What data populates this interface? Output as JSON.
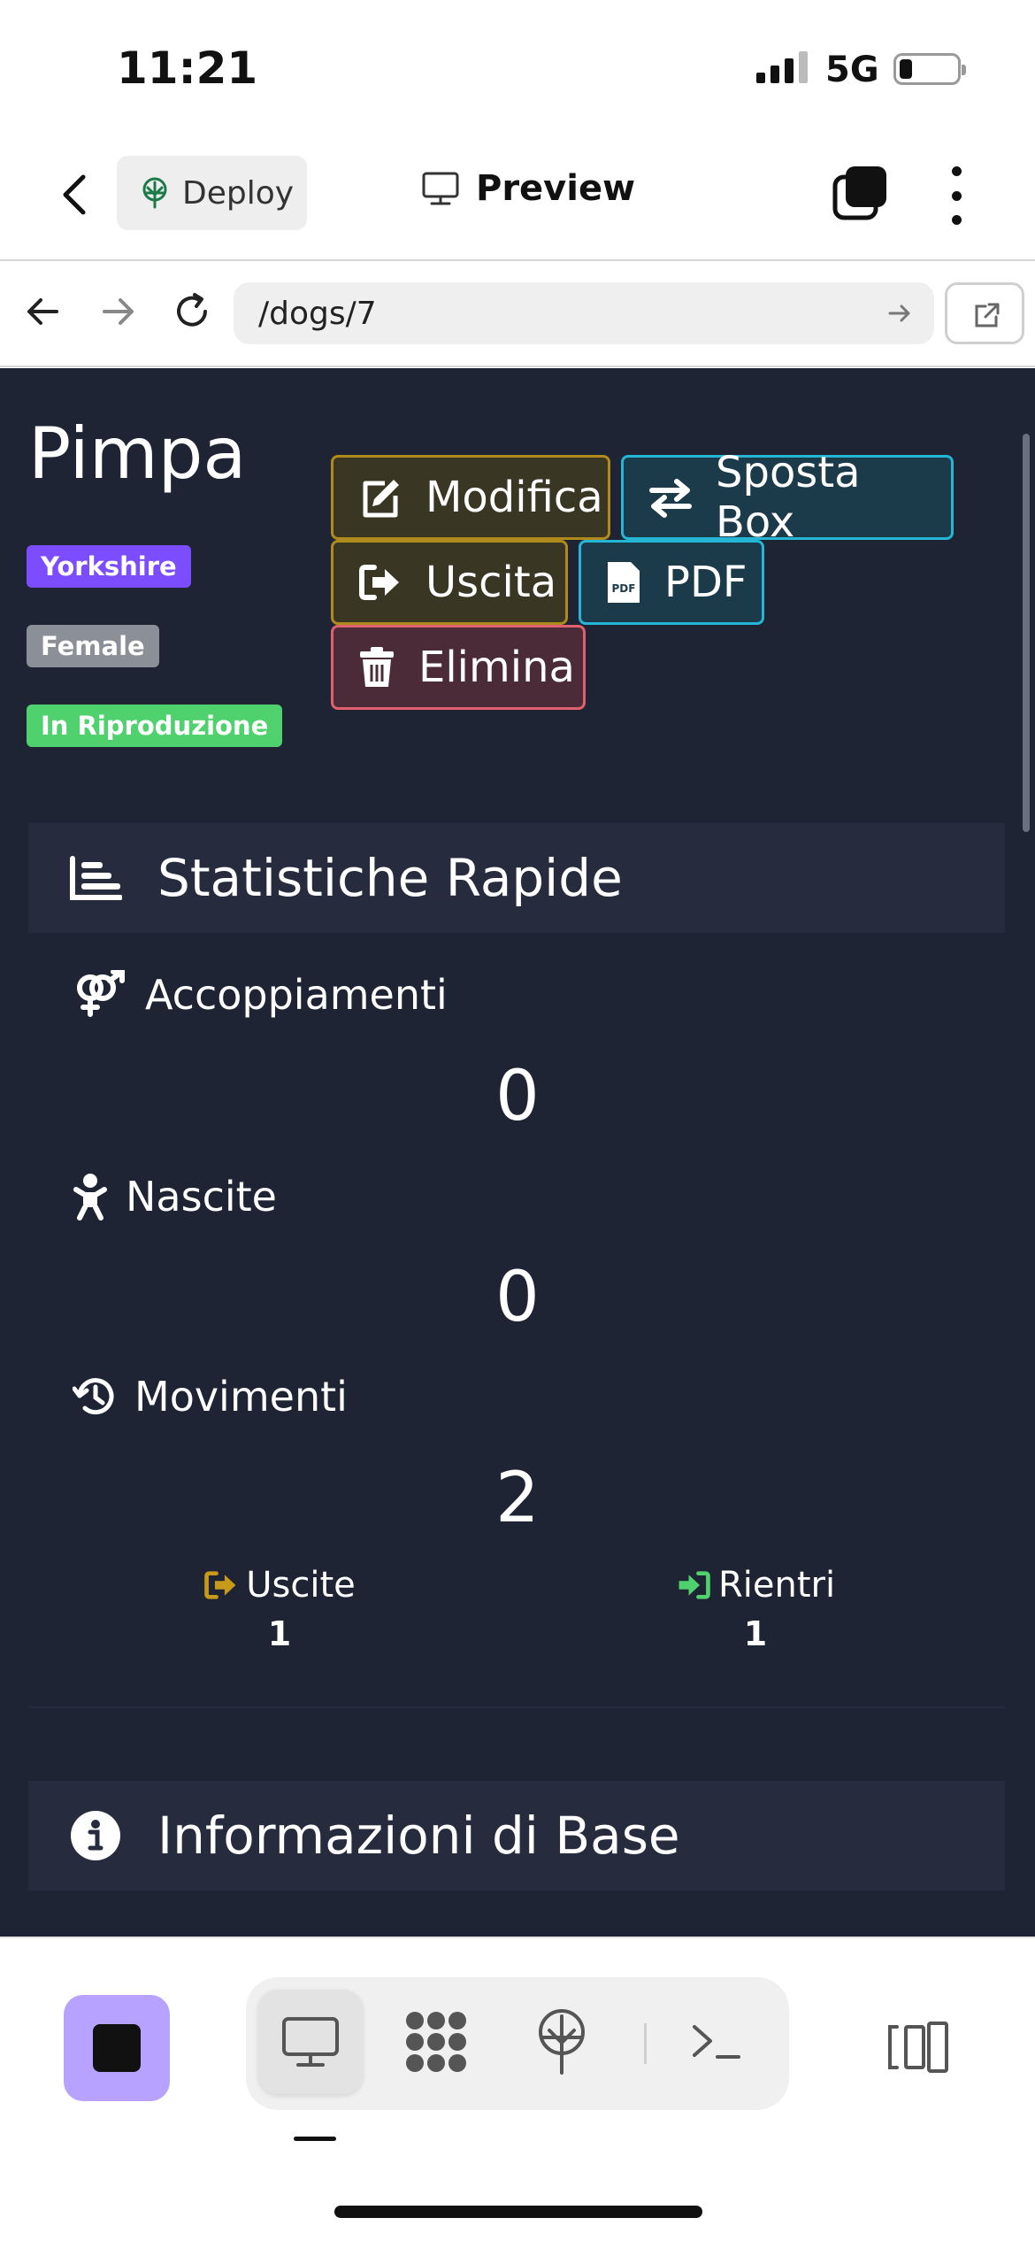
{
  "status_bar": {
    "time": "11:21",
    "network": "5G"
  },
  "app_bar": {
    "deploy_label": "Deploy",
    "preview_label": "Preview"
  },
  "browser": {
    "url": "/dogs/7"
  },
  "dog": {
    "name": "Pimpa",
    "tags": {
      "breed": "Yorkshire",
      "sex": "Female",
      "status": "In Riproduzione"
    }
  },
  "actions": {
    "edit": "Modifica",
    "move_box": "Sposta Box",
    "exit": "Uscita",
    "pdf": "PDF",
    "delete": "Elimina"
  },
  "stats": {
    "title": "Statistiche Rapide",
    "matings_label": "Accoppiamenti",
    "matings_value": "0",
    "births_label": "Nascite",
    "births_value": "0",
    "movements_label": "Movimenti",
    "movements_value": "2",
    "exits_label": "Uscite",
    "exits_value": "1",
    "returns_label": "Rientri",
    "returns_value": "1"
  },
  "info": {
    "title": "Informazioni di Base"
  },
  "colors": {
    "breed_tag": "#7c4dff",
    "status_tag": "#4fd16e",
    "warning": "#b08a1c",
    "info": "#25b6d6",
    "danger": "#e0606e",
    "page_bg": "#1e2433",
    "stop_button": "#b7a3ff"
  },
  "icons": {
    "back": "chevron-left-icon",
    "deploy": "deploy-tree-icon",
    "preview": "monitor-icon",
    "tabs": "layers-icon",
    "menu": "kebab-icon",
    "nav_back": "arrow-left-icon",
    "nav_forward": "arrow-right-icon",
    "reload": "reload-icon",
    "open_external": "external-link-icon",
    "stats": "chart-bar-icon",
    "matings": "gender-icon",
    "births": "baby-icon",
    "movements": "history-icon",
    "info": "info-circle-icon"
  }
}
